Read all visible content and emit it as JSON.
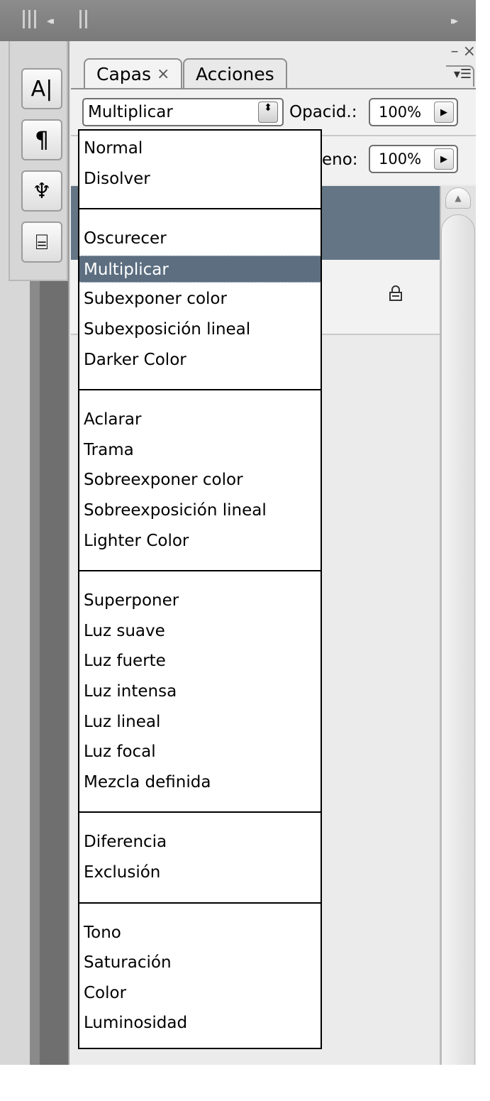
{
  "tabs": [
    {
      "label": "Capas",
      "close": "×"
    },
    {
      "label": "Acciones"
    }
  ],
  "window_controls": {
    "minimize": "–",
    "close": "×",
    "menu": "▾☰"
  },
  "topbar": {
    "collapse": "◂◂",
    "expand": "▸▸"
  },
  "blend_mode": {
    "value": "Multiplicar",
    "stepper": "⬍"
  },
  "opacity": {
    "label": "Opacid.:",
    "value": "100%"
  },
  "fill": {
    "label": "eno:",
    "value": "100%"
  },
  "tools": [
    {
      "icon": "character-panel-icon",
      "glyph": "A|"
    },
    {
      "icon": "paragraph-panel-icon",
      "glyph": "¶"
    },
    {
      "icon": "brushes-panel-icon",
      "glyph": "♆"
    },
    {
      "icon": "clone-source-panel-icon",
      "glyph": "⌸"
    }
  ],
  "scroll_up_glyph": "▲",
  "dropdown": {
    "groups": [
      [
        "Normal",
        "Disolver"
      ],
      [
        "Oscurecer",
        "Multiplicar",
        "Subexponer color",
        "Subexposición lineal",
        "Darker Color"
      ],
      [
        "Aclarar",
        "Trama",
        "Sobreexponer color",
        "Sobreexposición lineal",
        "Lighter Color"
      ],
      [
        "Superponer",
        "Luz suave",
        "Luz fuerte",
        "Luz intensa",
        "Luz lineal",
        "Luz focal",
        "Mezcla definida"
      ],
      [
        "Diferencia",
        "Exclusión"
      ],
      [
        "Tono",
        "Saturación",
        "Color",
        "Luminosidad"
      ]
    ],
    "selected": "Multiplicar"
  },
  "colors": {
    "selection": "#5c6e80",
    "layer_selected": "#647586",
    "chrome": "#7a7a7a"
  }
}
